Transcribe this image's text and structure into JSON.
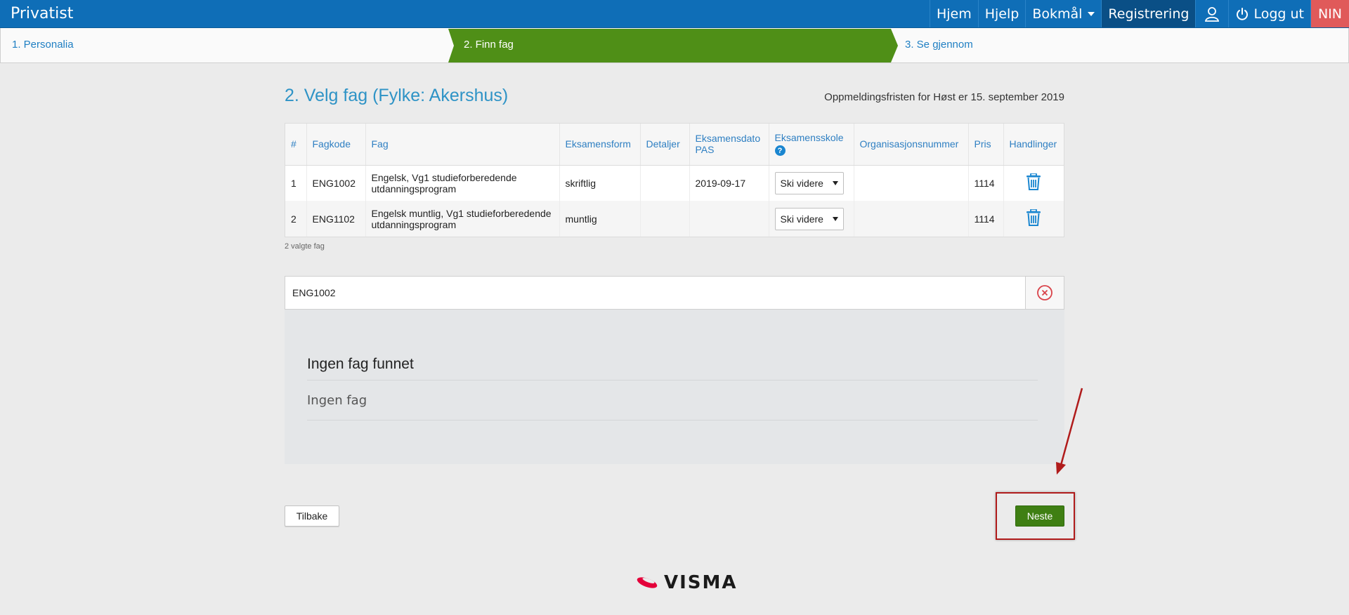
{
  "navbar": {
    "brand": "Privatist",
    "items": [
      {
        "label": "Hjem"
      },
      {
        "label": "Hjelp"
      },
      {
        "label": "Bokmål"
      },
      {
        "label": "Registrering"
      },
      {
        "label": "Logg ut"
      },
      {
        "label": "NIN"
      }
    ]
  },
  "steps": [
    {
      "label": "1. Personalia"
    },
    {
      "label": "2. Finn fag"
    },
    {
      "label": "3. Se gjennom"
    }
  ],
  "page": {
    "title": "2. Velg fag (Fylke: Akershus)",
    "deadline": "Oppmeldingsfristen for Høst er 15. september 2019"
  },
  "table": {
    "headers": {
      "num": "#",
      "code": "Fagkode",
      "subject": "Fag",
      "form": "Eksamensform",
      "details": "Detaljer",
      "date": "Eksamensdato PAS",
      "school": "Eksamensskole",
      "org": "Organisasjonsnummer",
      "price": "Pris",
      "actions": "Handlinger"
    },
    "rows": [
      {
        "num": "1",
        "code": "ENG1002",
        "subject": "Engelsk, Vg1 studieforberedende utdanningsprogram",
        "form": "skriftlig",
        "details": "",
        "date": "2019-09-17",
        "school": "Ski videre",
        "org": "",
        "price": "1114"
      },
      {
        "num": "2",
        "code": "ENG1102",
        "subject": "Engelsk muntlig, Vg1 studieforberedende utdanningsprogram",
        "form": "muntlig",
        "details": "",
        "date": "",
        "school": "Ski videre",
        "org": "",
        "price": "1114"
      }
    ],
    "count_text": "2 valgte fag"
  },
  "search": {
    "value": "ENG1002"
  },
  "results": {
    "title": "Ingen fag funnet",
    "empty_text": "Ingen fag"
  },
  "buttons": {
    "back": "Tilbake",
    "next": "Neste"
  },
  "footer": {
    "logo_text": "VISMA"
  },
  "colors": {
    "navbar": "#0f6eb7",
    "active_step": "#4f8f17",
    "next_button": "#3f7f13",
    "annotation": "#b01b1b"
  }
}
